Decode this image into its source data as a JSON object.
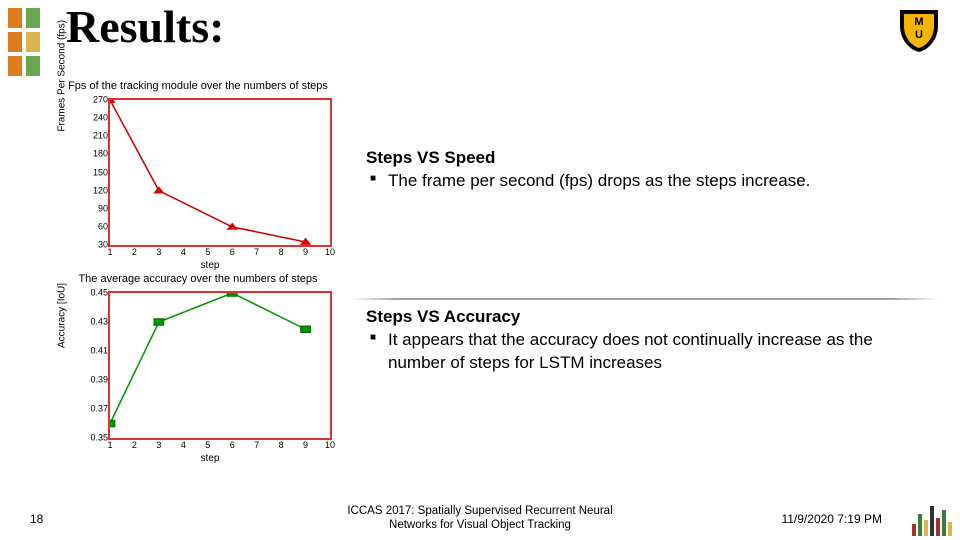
{
  "title": "Results:",
  "logo_left": {
    "colors_col1": [
      "#e07b1f",
      "#e07b1f",
      "#e07b1f"
    ],
    "colors_col2": [
      "#6aa84f",
      "#d9b64e",
      "#6aa84f"
    ]
  },
  "notes": {
    "top": {
      "head": "Steps VS Speed",
      "body": "The frame per second (fps) drops as the steps increase."
    },
    "bottom": {
      "head": "Steps VS Accuracy",
      "body": "It appears that the accuracy does not continually increase as the number of steps for LSTM increases"
    }
  },
  "footer": {
    "page": "18",
    "center_l1": "ICCAS 2017: Spatially Supervised Recurrent Neural",
    "center_l2": "Networks for Visual Object Tracking",
    "right": "11/9/2020 7:19 PM",
    "deco_colors": [
      "#b02a2a",
      "#3a7d3a",
      "#d9b64e",
      "#333",
      "#b02a2a",
      "#3a7d3a",
      "#d9b64e"
    ],
    "deco_heights": [
      12,
      22,
      16,
      30,
      18,
      26,
      14
    ]
  },
  "chart_data": [
    {
      "type": "line",
      "title": "Fps of the tracking module over the numbers of steps",
      "xlabel": "step",
      "ylabel": "Frames Per Second (fps)",
      "xlim": [
        1,
        10
      ],
      "ylim": [
        30,
        270
      ],
      "xticks": [
        1,
        2,
        3,
        4,
        5,
        6,
        7,
        8,
        9,
        10
      ],
      "yticks": [
        30,
        60,
        90,
        120,
        150,
        180,
        210,
        240,
        270
      ],
      "marker": "triangle",
      "color": "#d00000",
      "x": [
        1,
        3,
        6,
        9
      ],
      "values": [
        270,
        120,
        60,
        35
      ]
    },
    {
      "type": "line",
      "title": "The average accuracy over the numbers of steps",
      "xlabel": "step",
      "ylabel": "Accuracy [IoU]",
      "xlim": [
        1,
        10
      ],
      "ylim": [
        0.35,
        0.45
      ],
      "xticks": [
        1,
        2,
        3,
        4,
        5,
        6,
        7,
        8,
        9,
        10
      ],
      "yticks": [
        0.35,
        0.37,
        0.39,
        0.41,
        0.43,
        0.45
      ],
      "marker": "square",
      "color": "#009900",
      "x": [
        1,
        3,
        6,
        9
      ],
      "values": [
        0.36,
        0.43,
        0.45,
        0.425
      ]
    }
  ]
}
